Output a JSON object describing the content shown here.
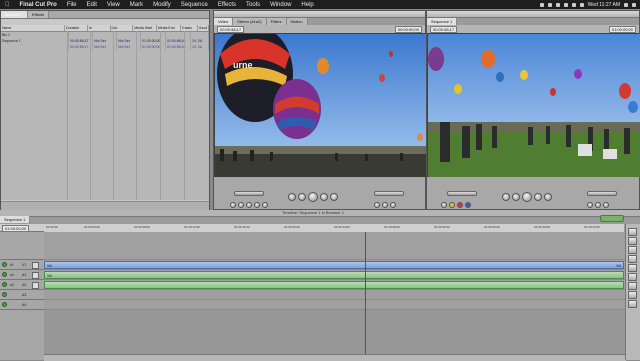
{
  "menubar": {
    "apple_icon": "apple-icon",
    "app_name": "Final Cut Pro",
    "menus": [
      "File",
      "Edit",
      "View",
      "Mark",
      "Modify",
      "Sequence",
      "Effects",
      "Tools",
      "Window",
      "Help"
    ],
    "clock": "Wed 11:27 AM"
  },
  "browser": {
    "tabs": [
      "Browser 1",
      "Effects"
    ],
    "columns": [
      "Name",
      "Duration",
      "In",
      "Out",
      "Media Start",
      "Media End",
      "Tracks",
      "Good"
    ],
    "rows": [
      {
        "name": "Bin 1",
        "duration": "",
        "in": "",
        "out": "",
        "media_start": "",
        "media_end": "",
        "tracks": ""
      },
      {
        "name": "Sequence 1",
        "duration": "00:00:58;17",
        "in": "Not Set",
        "out": "Not Set",
        "media_start": "01:00:00;00",
        "media_end": "01:00:58;16",
        "tracks": "1V, 2A"
      },
      {
        "name": "",
        "duration": "00:00:58;17",
        "in": "Not Set",
        "out": "Not Set",
        "media_start": "01:00:00;00",
        "media_end": "01:00:58;16",
        "tracks": "1V, 2A"
      }
    ]
  },
  "viewer": {
    "tabs": [
      "Video",
      "Stereo (a1a2)",
      "Filters",
      "Motion"
    ],
    "timecode_left": "00:00:58;17",
    "timecode_right": "00:00:00;00"
  },
  "canvas": {
    "tabs": [
      "Sequence 1"
    ],
    "timecode_left": "00:00:58;17",
    "timecode_right": "01:00:00;00"
  },
  "timeline": {
    "tab": "Sequence 1",
    "title": "Timeline: Sequence 1 in Browser 1",
    "current_timecode": "01:00:00;00",
    "ruler_ticks": [
      "01:00:00",
      "01:00:04:00",
      "01:00:08:00",
      "01:00:12:00",
      "01:00:16:00",
      "01:00:20:00",
      "01:00:24:00",
      "01:00:28:00",
      "01:00:32:00",
      "01:00:36:00",
      "01:00:40:00",
      "01:00:44:00"
    ],
    "tracks": [
      {
        "id": "v2",
        "label": "V2"
      },
      {
        "id": "v1",
        "label": "V1",
        "source": "v1"
      },
      {
        "id": "a1",
        "label": "A1",
        "source": "a1"
      },
      {
        "id": "a2",
        "label": "A2",
        "source": "a2"
      },
      {
        "id": "a3",
        "label": "A3"
      },
      {
        "id": "a4",
        "label": "A4"
      }
    ],
    "clip_label_start": "Vid",
    "clip_label_end": "Vid",
    "audio_label": "Vid"
  },
  "colors": {
    "menubar": "#1e1e1e",
    "video_clip": "#7fa3da",
    "audio_clip": "#8fc18a",
    "sky": "#4a86d6"
  }
}
